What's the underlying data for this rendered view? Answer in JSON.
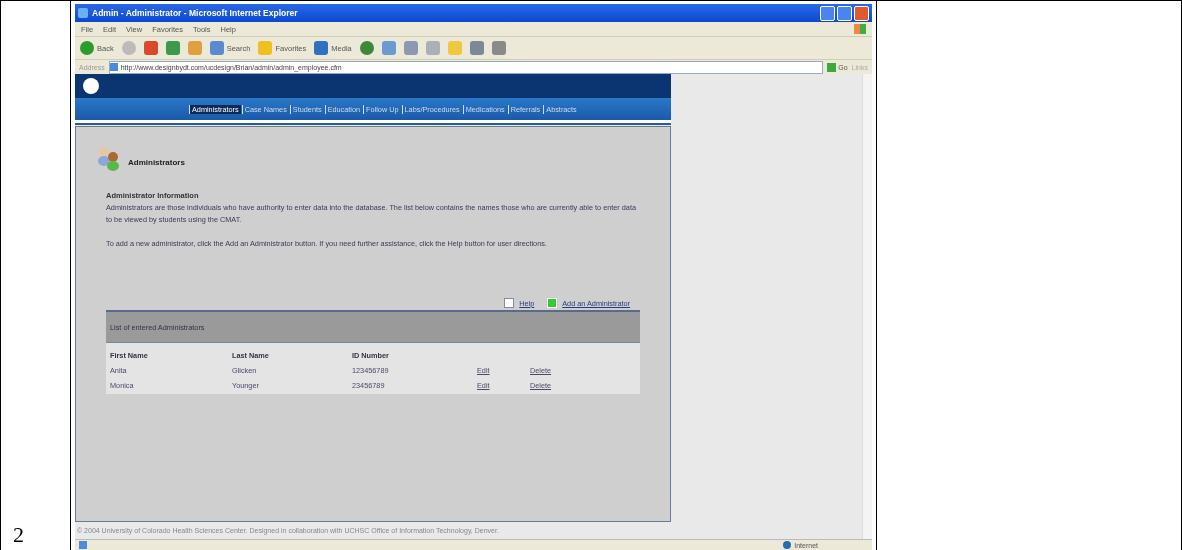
{
  "document": {
    "cell_number": "2"
  },
  "window": {
    "title": "Admin - Administrator - Microsoft Internet Explorer"
  },
  "menu": [
    "File",
    "Edit",
    "View",
    "Favorites",
    "Tools",
    "Help"
  ],
  "toolbar": [
    {
      "kind": "back",
      "label": "Back"
    },
    {
      "kind": "forward"
    },
    {
      "kind": "stop"
    },
    {
      "kind": "refresh"
    },
    {
      "kind": "home"
    },
    {
      "kind": "search",
      "label": "Search"
    },
    {
      "kind": "favorites",
      "label": "Favorites"
    },
    {
      "kind": "media",
      "label": "Media"
    },
    {
      "kind": "history"
    },
    {
      "kind": "mail"
    },
    {
      "kind": "print"
    },
    {
      "kind": "edit"
    },
    {
      "kind": "folder"
    },
    {
      "kind": "messenger"
    },
    {
      "kind": "discuss"
    }
  ],
  "address": {
    "label": "Address",
    "value": "http://www.designbydt.com/ucdesign/Brian/admin/admin_employee.cfm",
    "go": "Go",
    "links": "Links"
  },
  "nav": [
    {
      "label": "Administrators",
      "selected": true
    },
    {
      "label": "Case Names",
      "selected": false
    },
    {
      "label": "Students",
      "selected": false
    },
    {
      "label": "Education",
      "selected": false
    },
    {
      "label": "Follow Up",
      "selected": false
    },
    {
      "label": "Labs/Procedures",
      "selected": false
    },
    {
      "label": "Medications",
      "selected": false
    },
    {
      "label": "Referrals",
      "selected": false
    },
    {
      "label": "Abstracts",
      "selected": false
    }
  ],
  "page": {
    "title": "Administrators",
    "section_title": "Administrator Information",
    "paragraphs": [
      "Administrators are those individuals who have authority to enter data into the database. The list below contains the names those who are currently able to enter data to be viewed by students using the CMAT.",
      "To add a new administrator, click the Add an Administrator button. If you need further assistance, click the Help button for user directions."
    ],
    "help_link": "Help",
    "add_link": "Add an Administrator"
  },
  "table": {
    "caption": "List of entered Administrators",
    "columns": [
      "First Name",
      "Last Name",
      "ID Number"
    ],
    "rows": [
      {
        "first": "Anita",
        "last": "Glicken",
        "id": "123456789",
        "edit": "Edit",
        "delete": "Delete"
      },
      {
        "first": "Monica",
        "last": "Younger",
        "id": "23456789",
        "edit": "Edit",
        "delete": "Delete"
      }
    ]
  },
  "footer": "© 2004 University of Colorado Health Sciences Center. Designed in collaboration with UCHSC Office of Information Technology, Denver.",
  "status_bar": {
    "zone": "Internet"
  }
}
